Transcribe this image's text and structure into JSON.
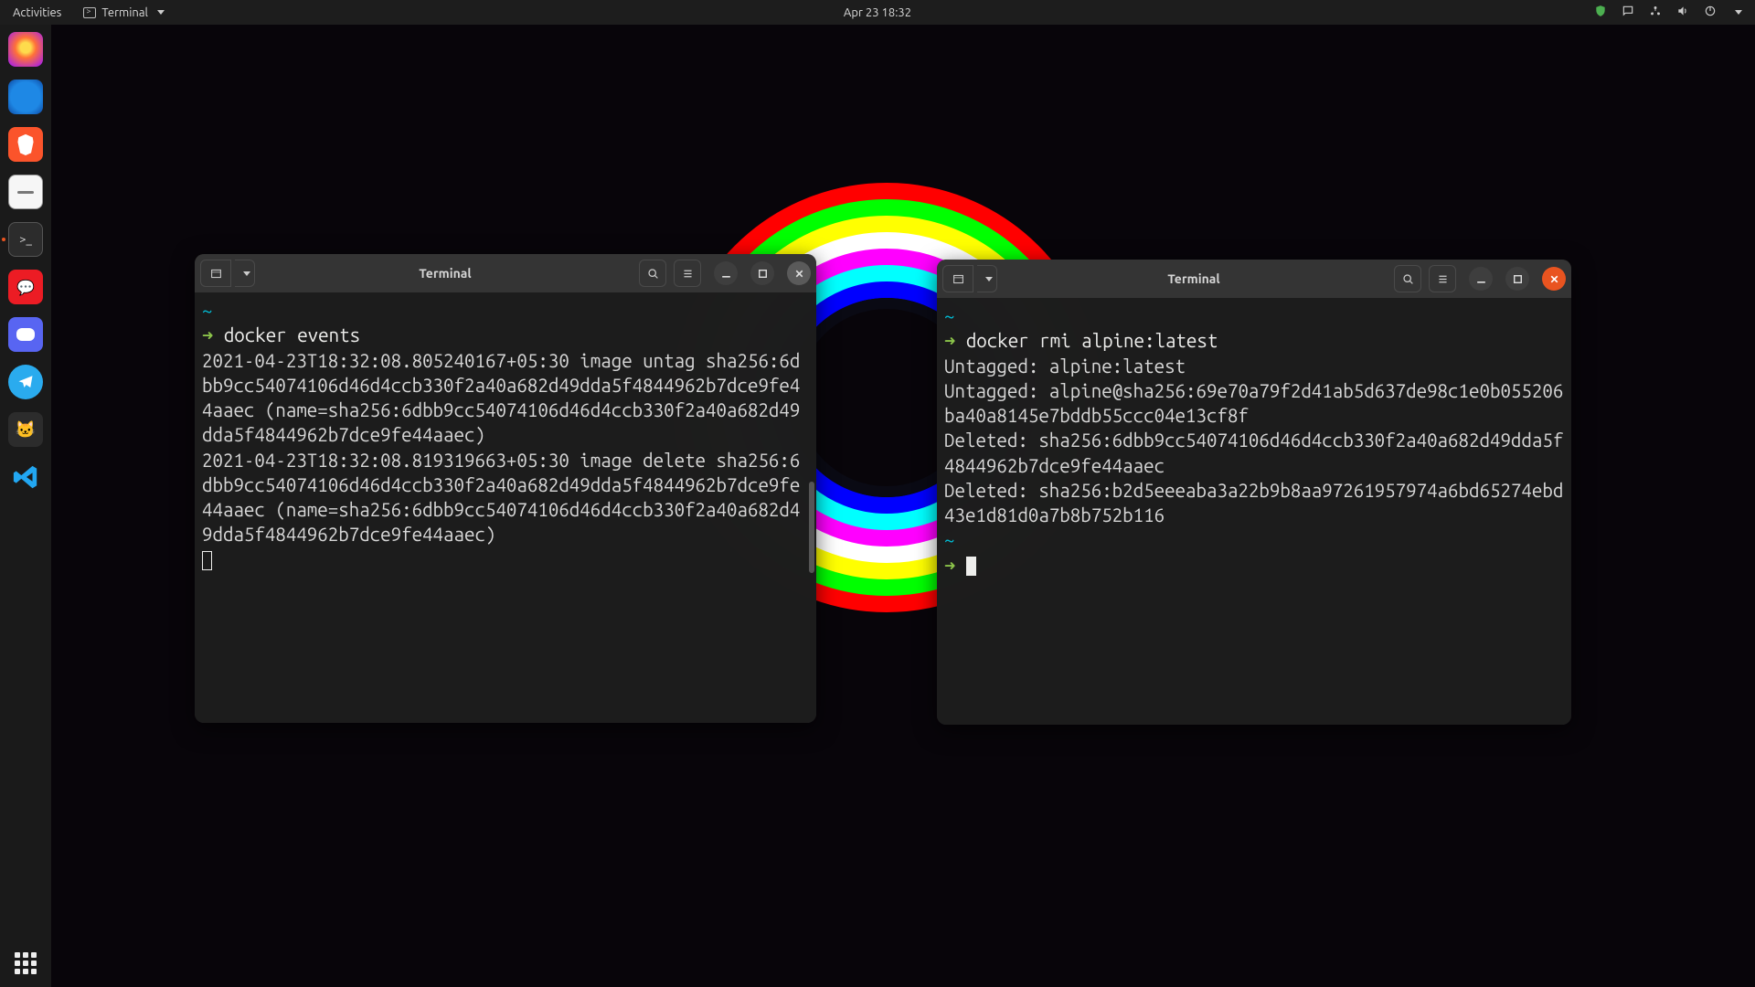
{
  "topbar": {
    "activities": "Activities",
    "app_name": "Terminal",
    "clock": "Apr 23  18:32"
  },
  "dock": {
    "items": [
      {
        "id": "firefox",
        "name": "Firefox"
      },
      {
        "id": "vivaldi",
        "name": "Web Browser"
      },
      {
        "id": "brave",
        "name": "Brave"
      },
      {
        "id": "files",
        "name": "Files"
      },
      {
        "id": "term",
        "name": "Terminal",
        "active": true
      },
      {
        "id": "red1",
        "name": "Chat App"
      },
      {
        "id": "discord",
        "name": "Discord"
      },
      {
        "id": "telegram",
        "name": "Telegram"
      },
      {
        "id": "kitty",
        "name": "Kitty"
      },
      {
        "id": "vscode",
        "name": "Visual Studio Code"
      }
    ]
  },
  "term_left": {
    "title": "Terminal",
    "prompt_tilde": "~",
    "prompt_arrow": "➜",
    "command": "docker events",
    "output": "2021-04-23T18:32:08.805240167+05:30 image untag sha256:6dbb9cc54074106d46d4ccb330f2a40a682d49dda5f4844962b7dce9fe44aaec (name=sha256:6dbb9cc54074106d46d4ccb330f2a40a682d49dda5f4844962b7dce9fe44aaec)\n2021-04-23T18:32:08.819319663+05:30 image delete sha256:6dbb9cc54074106d46d4ccb330f2a40a682d49dda5f4844962b7dce9fe44aaec (name=sha256:6dbb9cc54074106d46d4ccb330f2a40a682d49dda5f4844962b7dce9fe44aaec)"
  },
  "term_right": {
    "title": "Terminal",
    "prompt_tilde": "~",
    "prompt_arrow": "➜",
    "command": "docker rmi alpine:latest",
    "output": "Untagged: alpine:latest\nUntagged: alpine@sha256:69e70a79f2d41ab5d637de98c1e0b055206ba40a8145e7bddb55ccc04e13cf8f\nDeleted: sha256:6dbb9cc54074106d46d4ccb330f2a40a682d49dda5f4844962b7dce9fe44aaec\nDeleted: sha256:b2d5eeeaba3a22b9b8aa97261957974a6bd65274ebd43e1d81d0a7b8b752b116"
  }
}
